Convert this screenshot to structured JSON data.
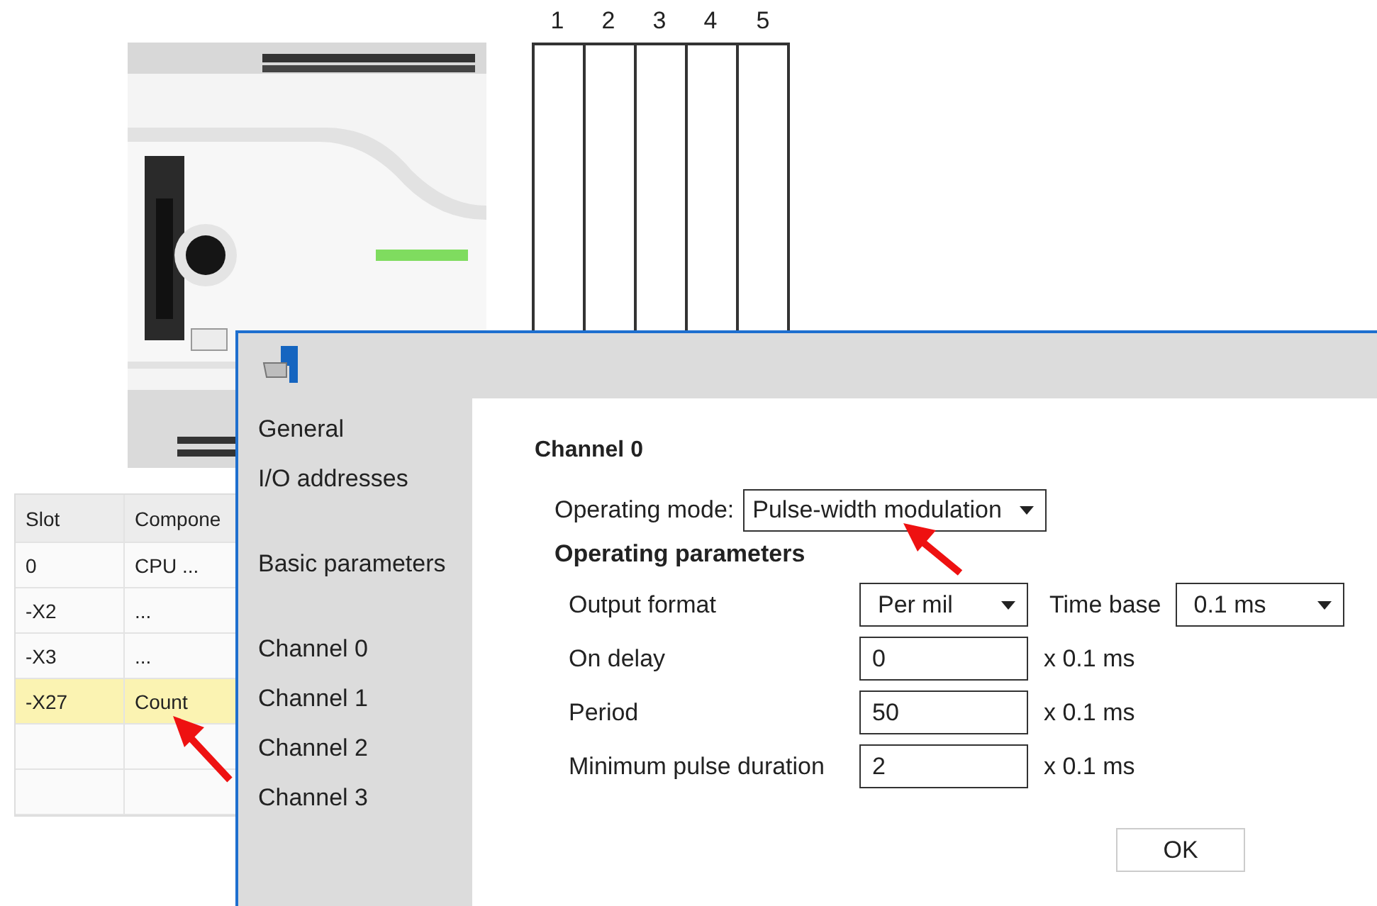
{
  "slot_diagram": {
    "slots": [
      "1",
      "2",
      "3",
      "4",
      "5"
    ]
  },
  "table": {
    "columns": [
      "Slot",
      "Compone"
    ],
    "rows": [
      {
        "cells": [
          "0",
          "CPU ..."
        ],
        "selected": false
      },
      {
        "cells": [
          "-X2",
          "..."
        ],
        "selected": false
      },
      {
        "cells": [
          "-X3",
          "..."
        ],
        "selected": false
      },
      {
        "cells": [
          "-X27",
          "Count"
        ],
        "selected": true
      }
    ]
  },
  "dialog": {
    "nav_groups": [
      [
        "General",
        "I/O addresses"
      ],
      [
        "Basic parameters"
      ],
      [
        "Channel 0",
        "Channel 1",
        "Channel 2",
        "Channel 3"
      ]
    ],
    "section_title": "Channel 0",
    "operating_mode": {
      "label": "Operating mode:",
      "value": "Pulse-width modulation"
    },
    "params_title": "Operating parameters",
    "params": [
      {
        "kind": "select",
        "label": "Output format",
        "value": "Per mil",
        "extra_label": "Time base",
        "extra_value": "0.1 ms"
      },
      {
        "kind": "input",
        "label": "On delay",
        "value": "0",
        "unit": "x 0.1 ms"
      },
      {
        "kind": "input",
        "label": "Period",
        "value": "50",
        "unit": "x 0.1 ms"
      },
      {
        "kind": "input",
        "label": "Minimum pulse duration",
        "value": "2",
        "unit": "x 0.1 ms"
      }
    ],
    "ok": "OK"
  }
}
